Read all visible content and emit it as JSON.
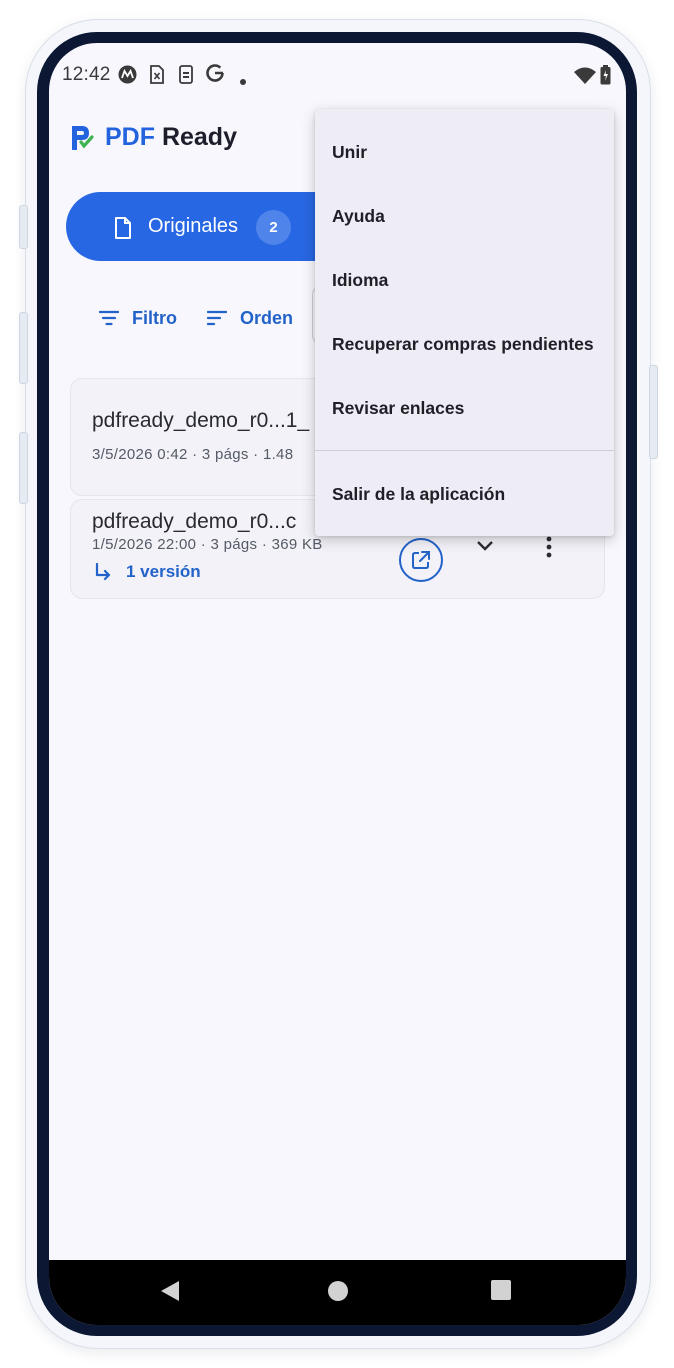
{
  "status_bar": {
    "time": "12:42",
    "left_icons": [
      "motorola-icon",
      "sim-icon",
      "phone-storage-icon",
      "google-icon",
      "dot-icon"
    ],
    "right_icons": [
      "wifi-icon",
      "battery-icon"
    ]
  },
  "app": {
    "title_brand": "PDF",
    "title_rest": " Ready",
    "logo_icon": "pdfready-logo-icon",
    "accent_color": "#2867e3"
  },
  "tabs": [
    {
      "label": "Originales",
      "count": "2",
      "active": true,
      "icon": "file-icon"
    }
  ],
  "toolbar": {
    "filter_label": "Filtro",
    "sort_label": "Orden"
  },
  "files": [
    {
      "title": "pdfready_demo_r0...1_",
      "meta": "3/5/2026 0:42 · 3 págs · 1.48"
    },
    {
      "title": "pdfready_demo_r0...c",
      "meta": "1/5/2026 22:00 · 3 págs · 369 KB",
      "versions_label": "1 versión"
    }
  ],
  "menu": {
    "items": [
      {
        "label": "Unir"
      },
      {
        "label": "Ayuda"
      },
      {
        "label": "Idioma"
      },
      {
        "label": "Recuperar compras pendientes"
      },
      {
        "label": "Revisar enlaces"
      }
    ],
    "footer_item": {
      "label": "Salir de la aplicación"
    }
  },
  "nav_bar": {
    "buttons": [
      "back-icon",
      "home-icon",
      "recents-icon"
    ]
  }
}
